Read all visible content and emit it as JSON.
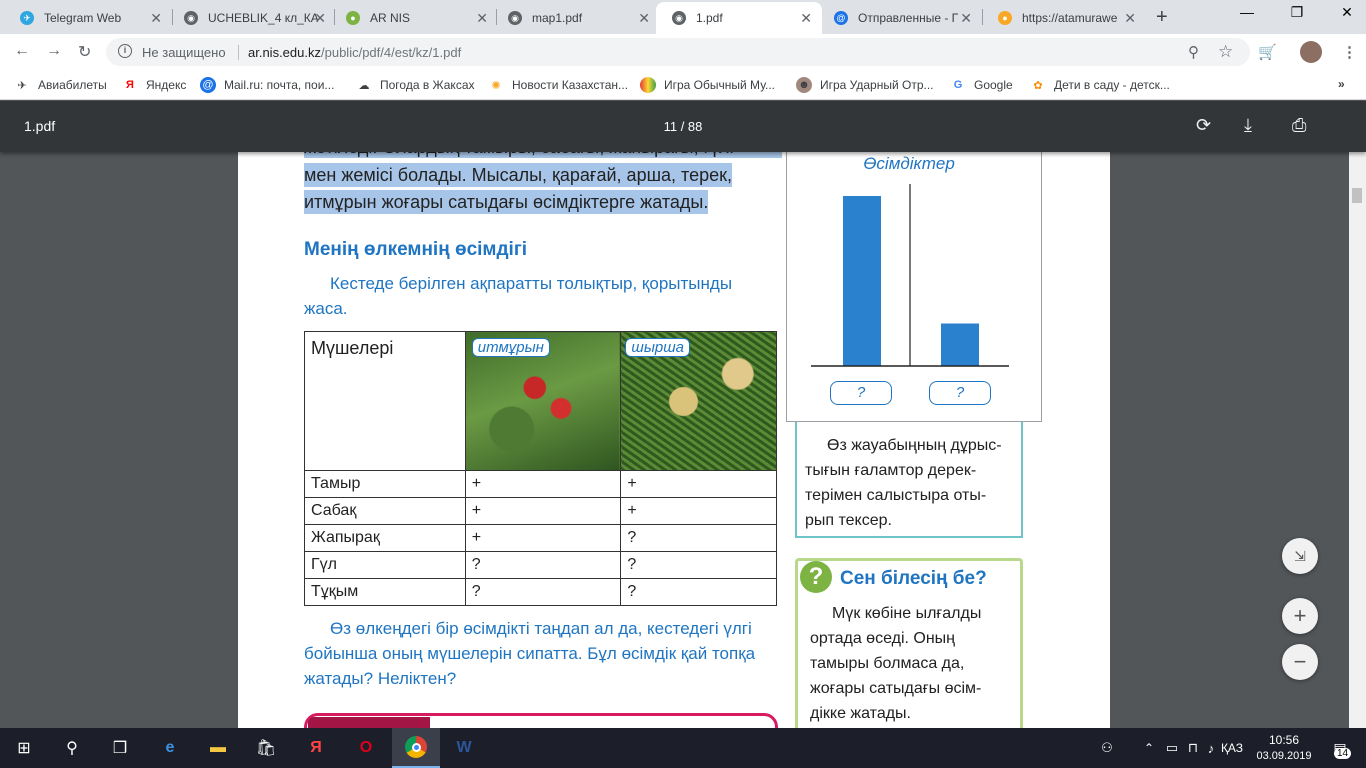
{
  "tabs": [
    {
      "title": "Telegram Web",
      "color": "#2ea6e0",
      "glyph": "✈"
    },
    {
      "title": "UCHEBLIK_4 кл_КА",
      "color": "#5f6368",
      "glyph": "◉"
    },
    {
      "title": "AR NIS",
      "color": "#7cb342",
      "glyph": "●"
    },
    {
      "title": "map1.pdf",
      "color": "#5f6368",
      "glyph": "◉"
    },
    {
      "title": "1.pdf",
      "color": "#5f6368",
      "glyph": "◉"
    },
    {
      "title": "Отправленные - Па",
      "color": "#1a73e8",
      "glyph": "@"
    },
    {
      "title": "https://atamurawe",
      "color": "#f9a825",
      "glyph": "●"
    }
  ],
  "toolbar": {
    "security": "Не защищено",
    "url_host": "ar.nis.edu.kz",
    "url_path": "/public/pdf/4/est/kz/1.pdf"
  },
  "bookmarks": [
    {
      "label": "Авиабилеты",
      "icon": "plane-icon"
    },
    {
      "label": "Яндекс",
      "icon": "yandex-icon"
    },
    {
      "label": "Mail.ru: почта, пои...",
      "icon": "mail-icon"
    },
    {
      "label": "Погода в Жаксах",
      "icon": "weather-icon"
    },
    {
      "label": "Новости Казахстан...",
      "icon": "news-icon"
    },
    {
      "label": "Игра Обычный Му...",
      "icon": "game-icon"
    },
    {
      "label": "Игра Ударный Отр...",
      "icon": "game-icon"
    },
    {
      "label": "Google",
      "icon": "google-icon"
    },
    {
      "label": "Дети в саду - детск...",
      "icon": "kids-icon"
    }
  ],
  "pdf": {
    "filename": "1.pdf",
    "page_indicator": "11 / 88"
  },
  "content": {
    "top_line_partial": "жетіледі. Олардың тамыры, сабағы, жапырағы, гүлі",
    "para_line2": "мен жемісі болады. Мысалы, қарағай, арша, терек,",
    "para_line3": "итмұрын жоғары сатыдағы өсімдіктерге жатады.",
    "section_heading": "Менің өлкемнің өсімдігі",
    "task_line1": "Кестеде берілген ақпаратты толықтыр, қорытынды",
    "task_line2": "жаса.",
    "table": {
      "header_label": "Мүшелері",
      "col1_label": "итмұрын",
      "col2_label": "шырша",
      "rows": [
        {
          "name": "Тамыр",
          "c1": "+",
          "c2": "+"
        },
        {
          "name": "Сабақ",
          "c1": "+",
          "c2": "+"
        },
        {
          "name": "Жапырақ",
          "c1": "+",
          "c2": "?"
        },
        {
          "name": "Гүл",
          "c1": "?",
          "c2": "?"
        },
        {
          "name": "Тұқым",
          "c1": "?",
          "c2": "?"
        }
      ]
    },
    "bottom_line1": "Өз өлкеңдегі бір өсімдікті таңдап ал да, кестедегі үлгі",
    "bottom_line2": "бойынша оның мүшелерін сипатта. Бұл өсімдік қай топқа",
    "bottom_line3": "жатады? Неліктен?",
    "chart_title": "Өсімдіктер",
    "chart_q1": "?",
    "chart_q2": "?",
    "check_line1": "Өз жауабыңның дұрыс-",
    "check_line2": "тығын ғаламтор дерек-",
    "check_line3": "терімен салыстыра оты-",
    "check_line4": "рып тексер.",
    "know_title": "Сен білесің бе?",
    "know_line1": "Мүк көбіне ылғалды",
    "know_line2": "ортада өседі. Оның",
    "know_line3": "тамыры болмаса да,",
    "know_line4": "жоғары сатыдағы өсім-",
    "know_line5": "дікке жатады."
  },
  "chart_data": {
    "type": "bar",
    "categories": [
      "?",
      "?"
    ],
    "values": [
      100,
      25
    ],
    "title": "Өсімдіктер"
  },
  "taskbar": {
    "lang": "ҚАЗ",
    "time": "10:56",
    "date": "03.09.2019",
    "notifications": "14"
  }
}
